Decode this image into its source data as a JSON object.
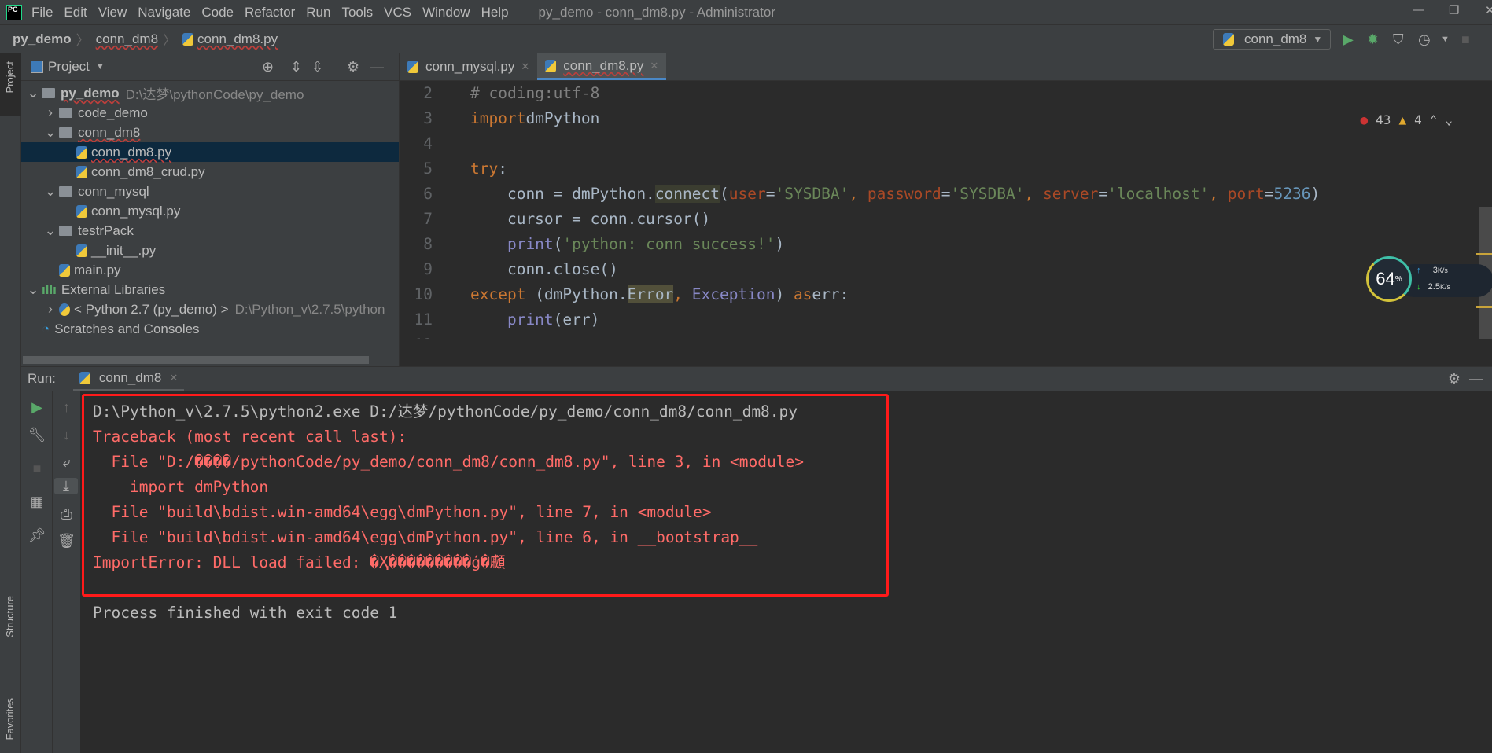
{
  "menubar": {
    "logo": "PC",
    "items": [
      "File",
      "Edit",
      "View",
      "Navigate",
      "Code",
      "Refactor",
      "Run",
      "Tools",
      "VCS",
      "Window",
      "Help"
    ],
    "title": "py_demo - conn_dm8.py - Administrator"
  },
  "breadcrumb": [
    "py_demo",
    "conn_dm8",
    "conn_dm8.py"
  ],
  "toolbar": {
    "run_config": "conn_dm8"
  },
  "side_labels": {
    "project": "Project",
    "structure": "Structure",
    "favorites": "Favorites"
  },
  "project": {
    "title": "Project",
    "tree": [
      {
        "label": "py_demo",
        "hint": "D:\\达梦\\pythonCode\\py_demo",
        "type": "folder",
        "depth": 0,
        "arrow": "v",
        "bold": true
      },
      {
        "label": "code_demo",
        "type": "folder",
        "depth": 1,
        "arrow": ">"
      },
      {
        "label": "conn_dm8",
        "type": "folder",
        "depth": 1,
        "arrow": "v"
      },
      {
        "label": "conn_dm8.py",
        "type": "py",
        "depth": 2,
        "selected": true
      },
      {
        "label": "conn_dm8_crud.py",
        "type": "py",
        "depth": 2
      },
      {
        "label": "conn_mysql",
        "type": "folder",
        "depth": 1,
        "arrow": "v"
      },
      {
        "label": "conn_mysql.py",
        "type": "py",
        "depth": 2
      },
      {
        "label": "testrPack",
        "type": "folder",
        "depth": 1,
        "arrow": "v"
      },
      {
        "label": "__init__.py",
        "type": "py",
        "depth": 2
      },
      {
        "label": "main.py",
        "type": "py",
        "depth": 1
      },
      {
        "label": "External Libraries",
        "type": "lib",
        "depth": 0,
        "arrow": "v"
      },
      {
        "label": "< Python 2.7 (py_demo) >",
        "hint": "D:\\Python_v\\2.7.5\\python",
        "type": "python",
        "depth": 1,
        "arrow": ">"
      },
      {
        "label": "Scratches and Consoles",
        "type": "scratch",
        "depth": 0
      }
    ]
  },
  "editor": {
    "tabs": [
      {
        "label": "conn_mysql.py",
        "active": false
      },
      {
        "label": "conn_dm8.py",
        "active": true
      }
    ],
    "errors": "43",
    "warnings": "4",
    "lines": [
      {
        "n": "2",
        "t": [
          [
            "cm",
            "# coding:utf-8"
          ]
        ]
      },
      {
        "n": "3",
        "t": [
          [
            "kw",
            "import"
          ],
          [
            "",
            "dmPython"
          ]
        ]
      },
      {
        "n": "4",
        "t": []
      },
      {
        "n": "5",
        "t": [
          [
            "kw",
            "try"
          ],
          [
            "",
            ":"
          ]
        ]
      },
      {
        "n": "6",
        "t": [
          [
            "",
            "    conn = dmPython."
          ],
          [
            "hl",
            "connect"
          ],
          [
            "",
            "("
          ],
          [
            "par",
            "user"
          ],
          [
            "",
            "="
          ],
          [
            "str",
            "'SYSDBA'"
          ],
          [
            "kw",
            ", "
          ],
          [
            "par",
            "password"
          ],
          [
            "",
            "="
          ],
          [
            "str",
            "'SYSDBA'"
          ],
          [
            "kw",
            ", "
          ],
          [
            "par",
            "server"
          ],
          [
            "",
            "="
          ],
          [
            "str",
            "'localhost'"
          ],
          [
            "kw",
            ", "
          ],
          [
            "par",
            "port"
          ],
          [
            "",
            "="
          ],
          [
            "num",
            "5236"
          ],
          [
            "",
            ")"
          ]
        ]
      },
      {
        "n": "7",
        "t": [
          [
            "",
            "    cursor = conn.cursor()"
          ]
        ]
      },
      {
        "n": "8",
        "t": [
          [
            "bi",
            "    print"
          ],
          [
            "",
            "("
          ],
          [
            "str",
            "'python: conn success!'"
          ],
          [
            "",
            ")"
          ]
        ]
      },
      {
        "n": "9",
        "t": [
          [
            "",
            "    conn.close()"
          ]
        ]
      },
      {
        "n": "10",
        "t": [
          [
            "kw",
            "except "
          ],
          [
            "",
            "(dmPython."
          ],
          [
            "hl2",
            "Error"
          ],
          [
            "kw",
            ", "
          ],
          [
            "bi",
            "Exception"
          ],
          [
            "",
            ") "
          ],
          [
            "kw",
            "as"
          ],
          [
            "",
            ""
          ],
          [
            "",
            "err:"
          ]
        ]
      },
      {
        "n": "11",
        "t": [
          [
            "bi",
            "    print"
          ],
          [
            "",
            "(err)"
          ]
        ]
      },
      {
        "n": "12",
        "t": []
      }
    ]
  },
  "net_widget": {
    "cpu": "64",
    "cpu_unit": "%",
    "up": "3",
    "up_unit": "K/s",
    "down": "2.5",
    "down_unit": "K/s"
  },
  "run": {
    "label": "Run:",
    "tab": "conn_dm8",
    "output": [
      {
        "cls": "norm",
        "text": "D:\\Python_v\\2.7.5\\python2.exe D:/达梦/pythonCode/py_demo/conn_dm8/conn_dm8.py"
      },
      {
        "cls": "err",
        "text": "Traceback (most recent call last):"
      },
      {
        "cls": "err",
        "text": "  File \"D:/����/pythonCode/py_demo/conn_dm8/conn_dm8.py\", line 3, in <module>"
      },
      {
        "cls": "err",
        "text": "    import dmPython"
      },
      {
        "cls": "err",
        "text": "  File \"build\\bdist.win-amd64\\egg\\dmPython.py\", line 7, in <module>"
      },
      {
        "cls": "err",
        "text": "  File \"build\\bdist.win-amd64\\egg\\dmPython.py\", line 6, in __bootstrap__"
      },
      {
        "cls": "err",
        "text": "ImportError: DLL load failed: �Ҳ���������ģ�顣"
      },
      {
        "cls": "norm",
        "text": ""
      },
      {
        "cls": "norm",
        "text": "Process finished with exit code 1"
      }
    ]
  },
  "colors": {
    "error_box": "#ff1a1a",
    "error_text": "#ff6b68",
    "selection": "#0d293e",
    "accent": "#4a88c7"
  }
}
